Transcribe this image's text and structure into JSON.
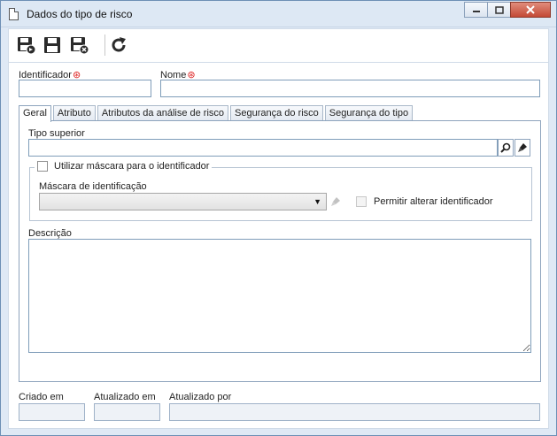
{
  "window": {
    "title": "Dados do tipo de risco",
    "minimize_icon": "minimize-icon",
    "maximize_icon": "maximize-icon",
    "close_icon": "close-icon"
  },
  "toolbar": {
    "buttons": [
      {
        "icon": "save-and-new-icon"
      },
      {
        "icon": "save-icon"
      },
      {
        "icon": "save-and-close-icon"
      },
      {
        "icon": "refresh-icon"
      }
    ]
  },
  "form": {
    "identificador_label": "Identificador",
    "identificador_value": "",
    "nome_label": "Nome",
    "nome_value": ""
  },
  "tabs": [
    {
      "label": "Geral",
      "active": true
    },
    {
      "label": "Atributo",
      "active": false
    },
    {
      "label": "Atributos da análise de risco",
      "active": false
    },
    {
      "label": "Segurança do risco",
      "active": false
    },
    {
      "label": "Segurança do tipo",
      "active": false
    }
  ],
  "geral": {
    "tipo_superior_label": "Tipo superior",
    "tipo_superior_value": "",
    "utilizar_mascara_label": "Utilizar máscara para o identificador",
    "utilizar_mascara_checked": false,
    "mascara_label": "Máscara de identificação",
    "mascara_value": "",
    "permitir_alterar_label": "Permitir alterar identificador",
    "permitir_alterar_checked": false,
    "descricao_label": "Descrição",
    "descricao_value": ""
  },
  "footer": {
    "criado_em_label": "Criado em",
    "criado_em_value": "",
    "atualizado_em_label": "Atualizado em",
    "atualizado_em_value": "",
    "atualizado_por_label": "Atualizado por",
    "atualizado_por_value": ""
  },
  "colors": {
    "required": "#dd2222",
    "frame_border": "#6d8fb5",
    "window_bg": "#dfe9f5"
  }
}
